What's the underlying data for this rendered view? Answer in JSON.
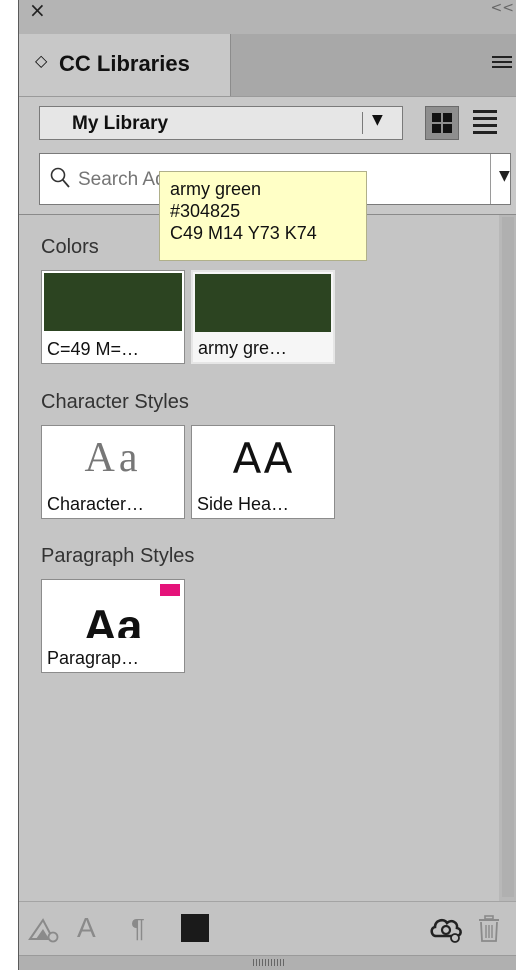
{
  "window": {
    "close_glyph": "×",
    "collapse_glyph": "<<"
  },
  "tab": {
    "chevron_glyph": "◇",
    "label": "CC Libraries"
  },
  "library_select": {
    "selected": "My Library",
    "arrow_glyph": "▼"
  },
  "view": {
    "grid_icon": "grid-view-icon",
    "list_icon": "list-view-icon"
  },
  "search": {
    "placeholder": "Search Adobe Stock",
    "arrow_glyph": "▼"
  },
  "sections": {
    "colors": {
      "label": "Colors",
      "items": [
        {
          "caption": "C=49 M=…",
          "swatch": "#2c4421"
        },
        {
          "caption": "army gre…",
          "swatch": "#2c4421"
        }
      ]
    },
    "character_styles": {
      "label": "Character Styles",
      "items": [
        {
          "caption": "Character…",
          "preview": "Aa"
        },
        {
          "caption": "Side Hea…",
          "preview": "AA"
        }
      ]
    },
    "paragraph_styles": {
      "label": "Paragraph Styles",
      "items": [
        {
          "caption": "Paragrap…",
          "preview": "Aa",
          "badge_color": "#e5137a"
        }
      ]
    }
  },
  "tooltip": {
    "line1": "army green",
    "line2": "#304825",
    "line3": "C49 M14 Y73 K74"
  },
  "toolbar": {
    "add_graphic_icon": "add-graphic-icon",
    "char_style_glyph": "A",
    "para_style_glyph": "¶",
    "fill_color": "#1a1a1a",
    "cc_icon": "creative-cloud-icon",
    "trash_icon": "trash-icon"
  },
  "colors": {
    "panel_bg": "#c8c8c8",
    "tab_strip_bg": "#a8a8a8",
    "accent_pink": "#e5137a",
    "tooltip_bg": "#ffffc6"
  }
}
